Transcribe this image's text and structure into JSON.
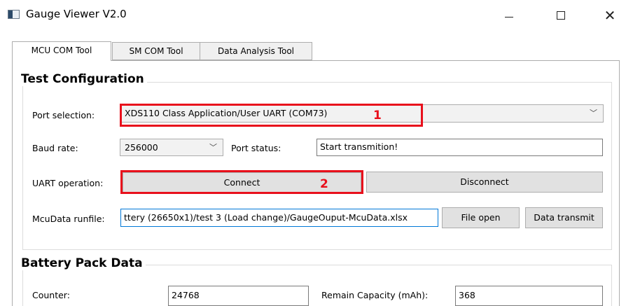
{
  "window": {
    "title": "Gauge Viewer V2.0",
    "minimize_glyph": "—",
    "maximize_glyph": "☐",
    "close_glyph": "✕"
  },
  "tabs": [
    {
      "label": "MCU COM Tool",
      "active": true
    },
    {
      "label": "SM COM Tool",
      "active": false
    },
    {
      "label": "Data Analysis Tool",
      "active": false
    }
  ],
  "test_config": {
    "title": "Test Configuration",
    "port_selection": {
      "label": "Port selection:",
      "value": "XDS110 Class Application/User UART (COM73)"
    },
    "baud_rate": {
      "label": "Baud rate:",
      "value": "256000"
    },
    "port_status": {
      "label": "Port status:",
      "value": "Start transmition!"
    },
    "uart_operation": {
      "label": "UART operation:",
      "connect_label": "Connect",
      "disconnect_label": "Disconnect"
    },
    "mcudata_runfile": {
      "label": "McuData runfile:",
      "value": "ttery (26650x1)/test 3 (Load change)/GaugeOuput-McuData.xlsx",
      "file_open_label": "File open",
      "data_transmit_label": "Data transmit"
    }
  },
  "battery_pack": {
    "title": "Battery Pack Data",
    "counter": {
      "label": "Counter:",
      "value": "24768"
    },
    "remain_capacity": {
      "label": "Remain Capacity (mAh):",
      "value": "368"
    }
  },
  "annotations": [
    {
      "marker": "1",
      "target": "port-selection"
    },
    {
      "marker": "2",
      "target": "connect-button"
    }
  ],
  "colors": {
    "annotation": "#e8101c",
    "focus_border": "#0078d7"
  }
}
